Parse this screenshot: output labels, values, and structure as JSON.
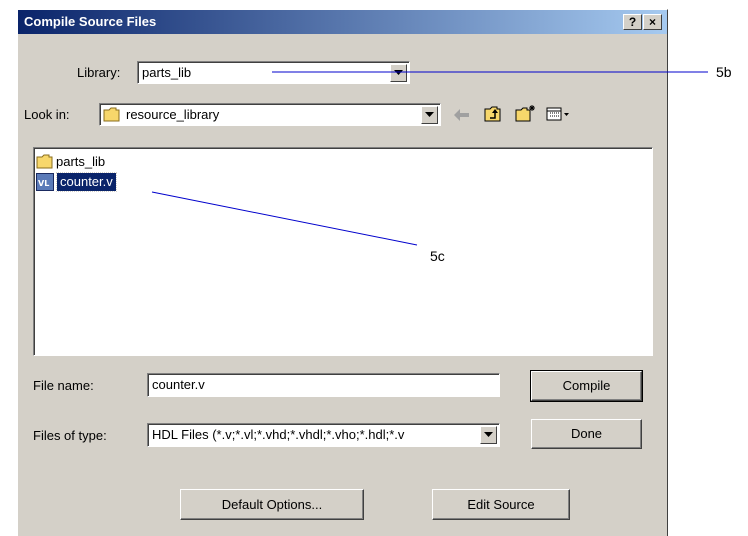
{
  "dialog": {
    "title": "Compile Source Files",
    "help_button": "?",
    "close_button": "×"
  },
  "library": {
    "label": "Library:",
    "value": "parts_lib"
  },
  "lookin": {
    "label": "Look in:",
    "value": "resource_library",
    "toolbar_icons": [
      "back-arrow-icon",
      "up-folder-icon",
      "new-folder-icon",
      "view-menu-icon"
    ]
  },
  "file_list": [
    {
      "name": "parts_lib",
      "icon": "folder-icon",
      "selected": false
    },
    {
      "name": "counter.v",
      "icon": "verilog-file-icon",
      "icon_text": "VL",
      "selected": true
    }
  ],
  "filename": {
    "label": "File name:",
    "value": "counter.v"
  },
  "filetype": {
    "label": "Files of type:",
    "value": "HDL Files (*.v;*.vl;*.vhd;*.vhdl;*.vho;*.hdl;*.v"
  },
  "buttons": {
    "compile": "Compile",
    "done": "Done",
    "default_options": "Default Options...",
    "edit_source": "Edit Source"
  },
  "callouts": {
    "library": "5b",
    "file": "5c"
  },
  "colors": {
    "dialog_bg": "#d4d0c8",
    "title_start": "#0a246a",
    "title_end": "#a6caf0",
    "selection": "#0a246a",
    "callout_line": "#0000cc"
  }
}
